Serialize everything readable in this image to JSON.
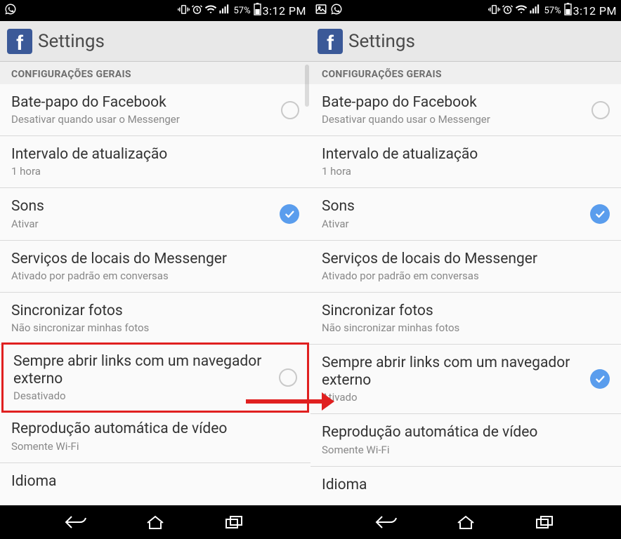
{
  "status": {
    "battery_pct": "57%",
    "time": "3:12 PM"
  },
  "appbar": {
    "title": "Settings"
  },
  "section": {
    "header": "CONFIGURAÇÕES GERAIS"
  },
  "rows": {
    "chat": {
      "title": "Bate-papo do Facebook",
      "sub": "Desativar quando usar o Messenger"
    },
    "interval": {
      "title": "Intervalo de atualização",
      "sub": "1 hora"
    },
    "sounds": {
      "title": "Sons",
      "sub": "Ativar"
    },
    "location": {
      "title": "Serviços de locais do Messenger",
      "sub": "Ativado por padrão em conversas"
    },
    "photos": {
      "title": "Sincronizar fotos",
      "sub": "Não sincronizar minhas fotos"
    },
    "links": {
      "title": "Sempre abrir links com um navegador externo",
      "sub_off": "Desativado",
      "sub_on": "Ativado"
    },
    "video": {
      "title": "Reprodução automática de vídeo",
      "sub": "Somente Wi-Fi"
    },
    "language": {
      "title": "Idioma"
    }
  }
}
